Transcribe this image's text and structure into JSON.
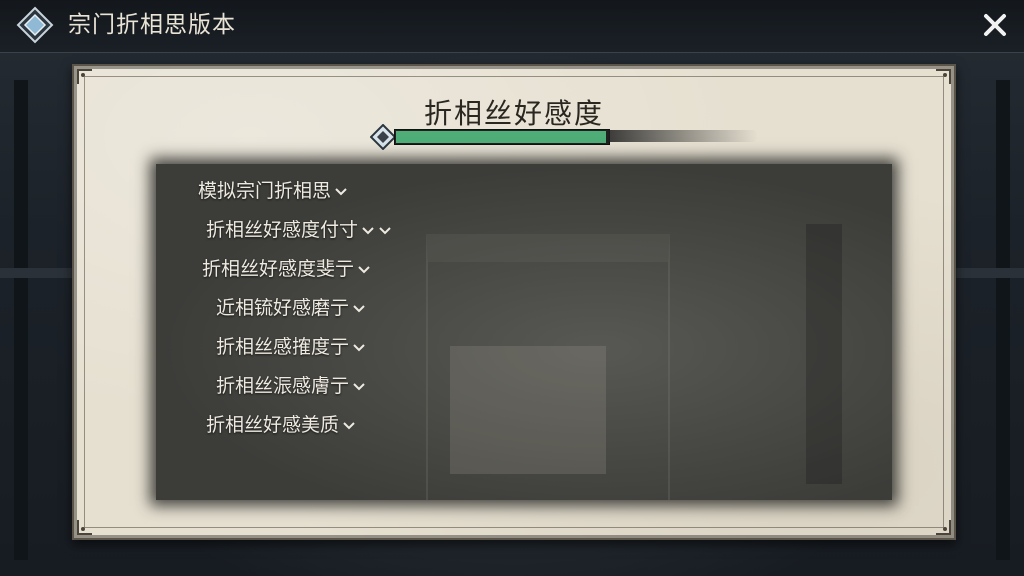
{
  "header": {
    "title": "宗门折相思版本",
    "emblem_icon": "diamond-emblem-icon",
    "close_icon": "close-icon"
  },
  "panel": {
    "title": "折相丝好感度",
    "affinity": {
      "level_fraction": 0.98,
      "fill_color": "#4fae78",
      "marker_icon": "diamond-marker-icon"
    },
    "options": [
      {
        "label": "模拟宗门折相思",
        "chevrons": 1
      },
      {
        "label": "折相丝好感度付寸",
        "chevrons": 2
      },
      {
        "label": "折相丝好感度斐亍",
        "chevrons": 1
      },
      {
        "label": "近相锍好感磨亍",
        "chevrons": 1
      },
      {
        "label": "折相丝感搉度亍",
        "chevrons": 1
      },
      {
        "label": "折相丝浱感膚亍",
        "chevrons": 1
      },
      {
        "label": "折相丝好感美质",
        "chevrons": 1
      }
    ]
  }
}
